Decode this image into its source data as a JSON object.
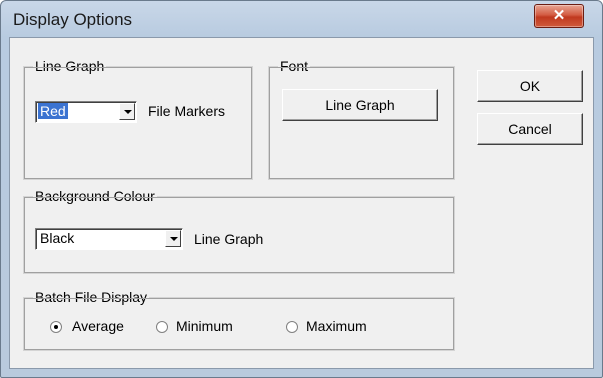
{
  "window": {
    "title": "Display Options",
    "close_glyph": "✕"
  },
  "line_graph_group": {
    "legend": "Line Graph",
    "combo_value": "Red",
    "combo_label": "File Markers"
  },
  "font_group": {
    "legend": "Font",
    "button_label": "Line Graph"
  },
  "buttons": {
    "ok": "OK",
    "cancel": "Cancel"
  },
  "background_group": {
    "legend": "Background Colour",
    "combo_value": "Black",
    "combo_label": "Line Graph"
  },
  "batch_group": {
    "legend": "Batch File Display",
    "options": [
      {
        "label": "Average",
        "checked": true
      },
      {
        "label": "Minimum",
        "checked": false
      },
      {
        "label": "Maximum",
        "checked": false
      }
    ]
  },
  "colors": {
    "selection": "#3b73d1",
    "close_button": "#c0391f",
    "face": "#f0f0f0"
  }
}
